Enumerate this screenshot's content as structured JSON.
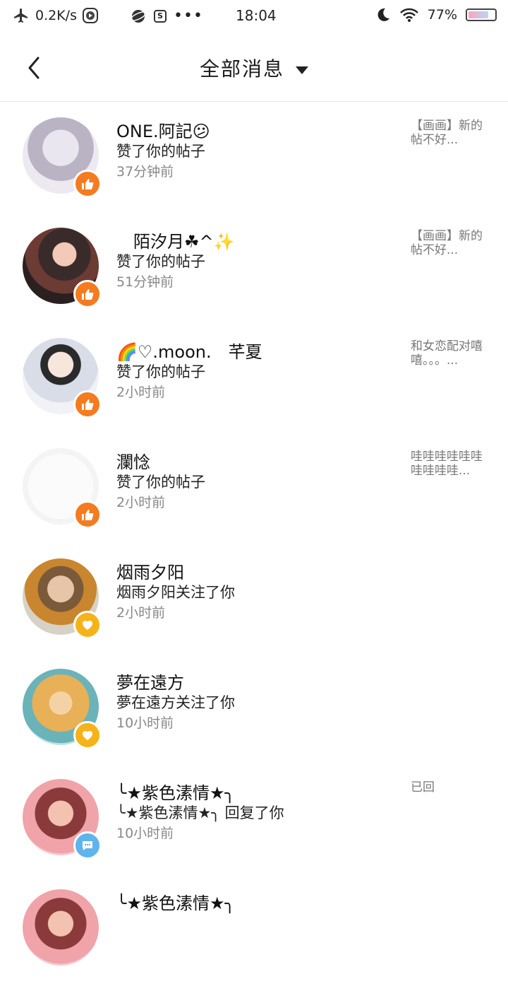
{
  "status_bar": {
    "net_speed": "0.2K/s",
    "time": "18:04",
    "battery": "77%",
    "battery_level": 0.77,
    "icons": [
      "airplane-icon",
      "record-icon",
      "planet-icon",
      "s-box-icon",
      "more-dots-icon",
      "moon-icon",
      "wifi-icon",
      "battery-icon"
    ]
  },
  "header": {
    "title": "全部消息"
  },
  "messages": [
    {
      "name": "ONE.阿記😕",
      "action": "赞了你的帖子",
      "time": "37分钟前",
      "preview": "【画画】新的帖不好...",
      "badge": "like"
    },
    {
      "name": "　陌汐月☘^✨",
      "action": "赞了你的帖子",
      "time": "51分钟前",
      "preview": "【画画】新的帖不好...",
      "badge": "like"
    },
    {
      "name": "🌈♡.moon.　芊夏",
      "action": "赞了你的帖子",
      "time": "2小时前",
      "preview": "和女恋配对嘻嘻。。。...",
      "badge": "like"
    },
    {
      "name": "瀾惗",
      "action": "赞了你的帖子",
      "time": "2小时前",
      "preview": "哇哇哇哇哇哇哇哇哇哇...",
      "badge": "like"
    },
    {
      "name": "烟雨夕阳",
      "action": "烟雨夕阳关注了你",
      "time": "2小时前",
      "preview": "",
      "badge": "heart"
    },
    {
      "name": "夢在遠方",
      "action": "夢在遠方关注了你",
      "time": "10小时前",
      "preview": "",
      "badge": "heart"
    },
    {
      "name": "╰★紫色溸情★╮",
      "action": "╰★紫色溸情★╮ 回复了你",
      "time": "10小时前",
      "preview": "已回",
      "badge": "comment"
    },
    {
      "name": "╰★紫色溸情★╮",
      "action": "",
      "time": "",
      "preview": "",
      "badge": "none"
    }
  ],
  "colors": {
    "like": "#f47b20",
    "heart": "#f6b319",
    "comment": "#5fb4ec"
  }
}
